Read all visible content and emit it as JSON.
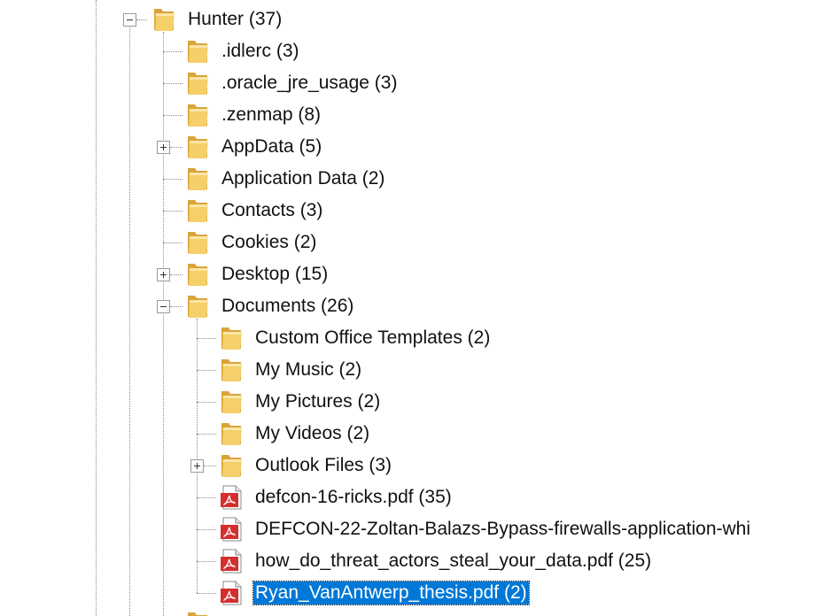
{
  "tree": {
    "root": {
      "label": "Hunter (37)",
      "expanded": true
    },
    "items": [
      {
        "label": ".idlerc (3)",
        "type": "folder",
        "expander": "none"
      },
      {
        "label": ".oracle_jre_usage (3)",
        "type": "folder",
        "expander": "none"
      },
      {
        "label": ".zenmap (8)",
        "type": "folder",
        "expander": "none"
      },
      {
        "label": "AppData (5)",
        "type": "folder",
        "expander": "plus"
      },
      {
        "label": "Application Data (2)",
        "type": "folder",
        "expander": "none"
      },
      {
        "label": "Contacts (3)",
        "type": "folder",
        "expander": "none"
      },
      {
        "label": "Cookies (2)",
        "type": "folder",
        "expander": "none"
      },
      {
        "label": "Desktop (15)",
        "type": "folder",
        "expander": "plus"
      },
      {
        "label": "Documents (26)",
        "type": "folder",
        "expander": "minus"
      }
    ],
    "documents_children": [
      {
        "label": "Custom Office Templates (2)",
        "type": "folder",
        "expander": "none"
      },
      {
        "label": "My Music (2)",
        "type": "folder",
        "expander": "none"
      },
      {
        "label": "My Pictures (2)",
        "type": "folder",
        "expander": "none"
      },
      {
        "label": "My Videos (2)",
        "type": "folder",
        "expander": "none"
      },
      {
        "label": "Outlook Files (3)",
        "type": "folder",
        "expander": "plus"
      },
      {
        "label": "defcon-16-ricks.pdf (35)",
        "type": "pdf",
        "expander": "none"
      },
      {
        "label": "DEFCON-22-Zoltan-Balazs-Bypass-firewalls-application-whi",
        "type": "pdf",
        "expander": "none"
      },
      {
        "label": "how_do_threat_actors_steal_your_data.pdf (25)",
        "type": "pdf",
        "expander": "none"
      },
      {
        "label": "Ryan_VanAntwerp_thesis.pdf (2)",
        "type": "pdf",
        "expander": "none",
        "selected": true
      }
    ]
  },
  "colors": {
    "selection": "#0078d7",
    "folder": "#e8b84a",
    "pdf": "#d32f2f"
  }
}
